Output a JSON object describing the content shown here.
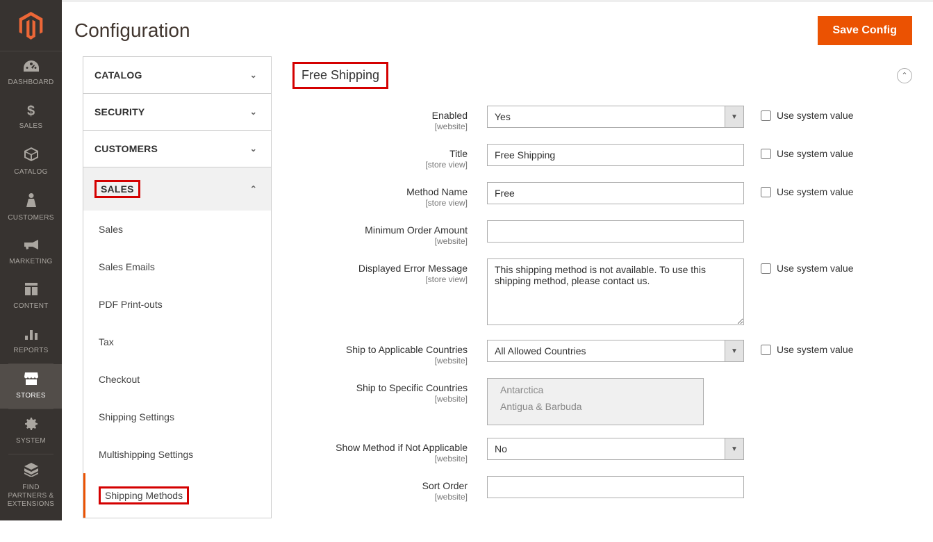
{
  "page": {
    "title": "Configuration",
    "save_button": "Save Config"
  },
  "nav": {
    "items": [
      {
        "label": "DASHBOARD",
        "icon": "dashboard"
      },
      {
        "label": "SALES",
        "icon": "dollar"
      },
      {
        "label": "CATALOG",
        "icon": "box"
      },
      {
        "label": "CUSTOMERS",
        "icon": "person"
      },
      {
        "label": "MARKETING",
        "icon": "megaphone"
      },
      {
        "label": "CONTENT",
        "icon": "layout"
      },
      {
        "label": "REPORTS",
        "icon": "bars"
      },
      {
        "label": "STORES",
        "icon": "store",
        "active": true
      },
      {
        "label": "SYSTEM",
        "icon": "gear"
      },
      {
        "label": "FIND PARTNERS & EXTENSIONS",
        "icon": "puzzle"
      }
    ]
  },
  "tabs": {
    "sections": [
      {
        "label": "CATALOG",
        "expanded": false
      },
      {
        "label": "SECURITY",
        "expanded": false
      },
      {
        "label": "CUSTOMERS",
        "expanded": false
      },
      {
        "label": "SALES",
        "expanded": true,
        "highlighted": true,
        "children": [
          {
            "label": "Sales"
          },
          {
            "label": "Sales Emails"
          },
          {
            "label": "PDF Print-outs"
          },
          {
            "label": "Tax"
          },
          {
            "label": "Checkout"
          },
          {
            "label": "Shipping Settings"
          },
          {
            "label": "Multishipping Settings"
          },
          {
            "label": "Shipping Methods",
            "active": true,
            "highlighted": true
          }
        ]
      }
    ]
  },
  "section": {
    "title": "Free Shipping",
    "highlighted": true
  },
  "fields": {
    "enabled": {
      "label": "Enabled",
      "scope": "[website]",
      "value": "Yes",
      "use_system_label": "Use system value"
    },
    "title": {
      "label": "Title",
      "scope": "[store view]",
      "value": "Free Shipping",
      "use_system_label": "Use system value"
    },
    "method_name": {
      "label": "Method Name",
      "scope": "[store view]",
      "value": "Free",
      "use_system_label": "Use system value"
    },
    "min_order": {
      "label": "Minimum Order Amount",
      "scope": "[website]",
      "value": ""
    },
    "error_msg": {
      "label": "Displayed Error Message",
      "scope": "[store view]",
      "value": "This shipping method is not available. To use this shipping method, please contact us.",
      "use_system_label": "Use system value"
    },
    "ship_applicable": {
      "label": "Ship to Applicable Countries",
      "scope": "[website]",
      "value": "All Allowed Countries",
      "use_system_label": "Use system value"
    },
    "ship_specific": {
      "label": "Ship to Specific Countries",
      "scope": "[website]",
      "options": [
        "Antarctica",
        "Antigua & Barbuda"
      ]
    },
    "show_method": {
      "label": "Show Method if Not Applicable",
      "scope": "[website]",
      "value": "No"
    },
    "sort_order": {
      "label": "Sort Order",
      "scope": "[website]",
      "value": ""
    }
  }
}
